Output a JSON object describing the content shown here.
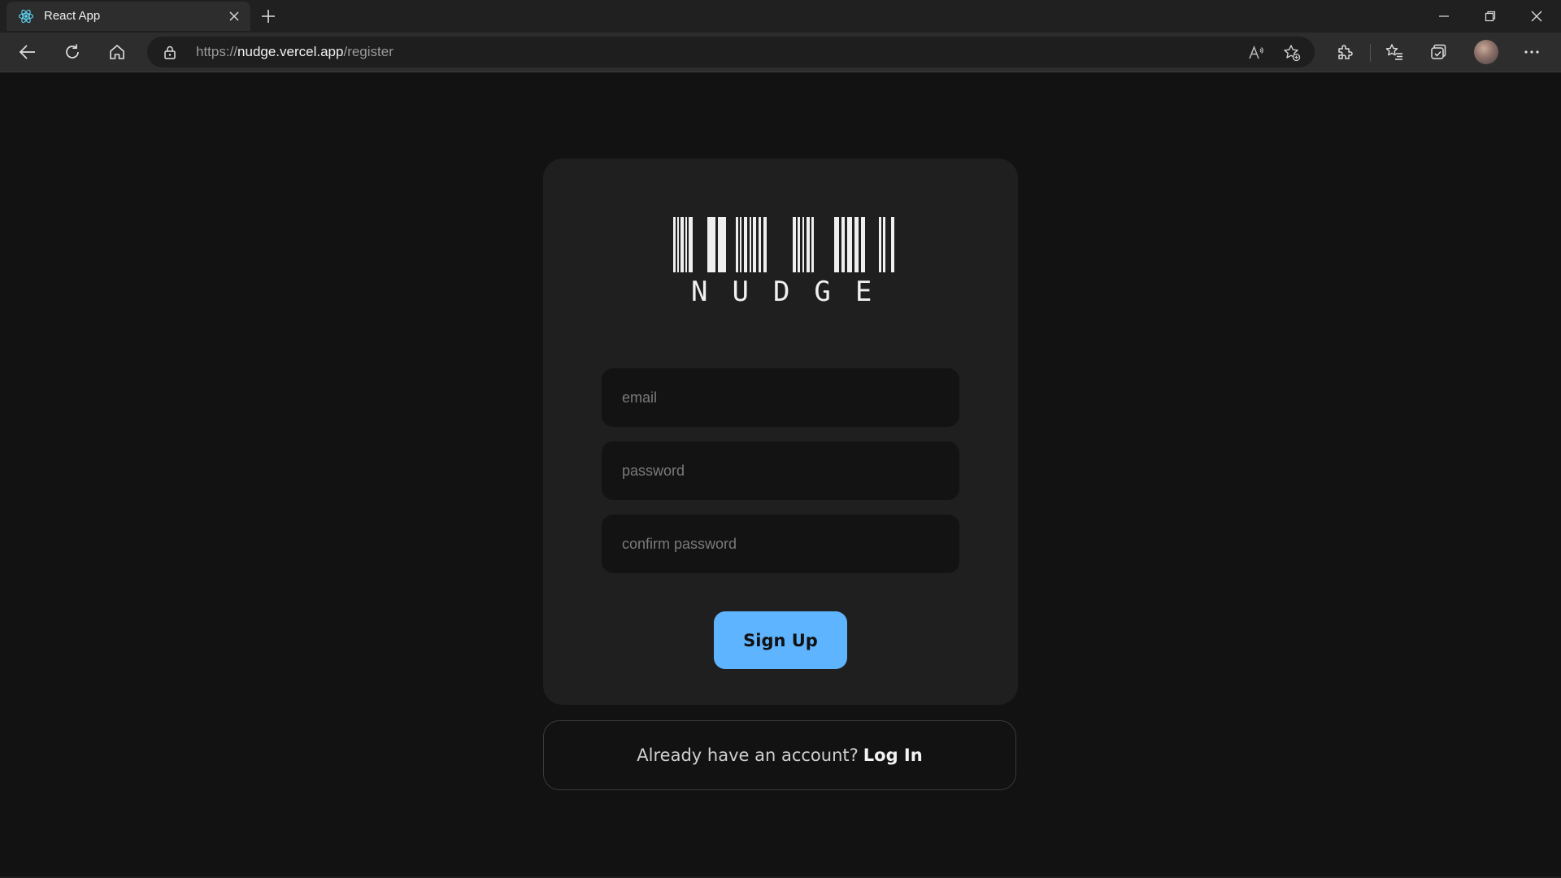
{
  "browser": {
    "tab_title": "React App",
    "url_scheme": "https://",
    "url_host": "nudge.vercel.app",
    "url_path": "/register",
    "icons": {
      "favicon": "react-icon",
      "close": "close-icon",
      "new_tab": "plus-icon",
      "back": "back-arrow-icon",
      "refresh": "refresh-icon",
      "home": "home-icon",
      "lock": "lock-icon",
      "read_aloud": "read-aloud-icon",
      "favorite": "add-favorite-icon",
      "extensions": "puzzle-icon",
      "favorites": "favorites-list-icon",
      "collections": "collections-icon",
      "more": "more-dots-icon"
    }
  },
  "register": {
    "logo_text": "NUDGE",
    "email_placeholder": "email",
    "password_placeholder": "password",
    "confirm_placeholder": "confirm password",
    "signup_label": "Sign Up",
    "login_prompt": "Already have an account?",
    "login_link": "Log In"
  },
  "colors": {
    "background": "#121212",
    "card": "#1f1f1f",
    "input": "#131313",
    "accent": "#5fb4ff"
  }
}
